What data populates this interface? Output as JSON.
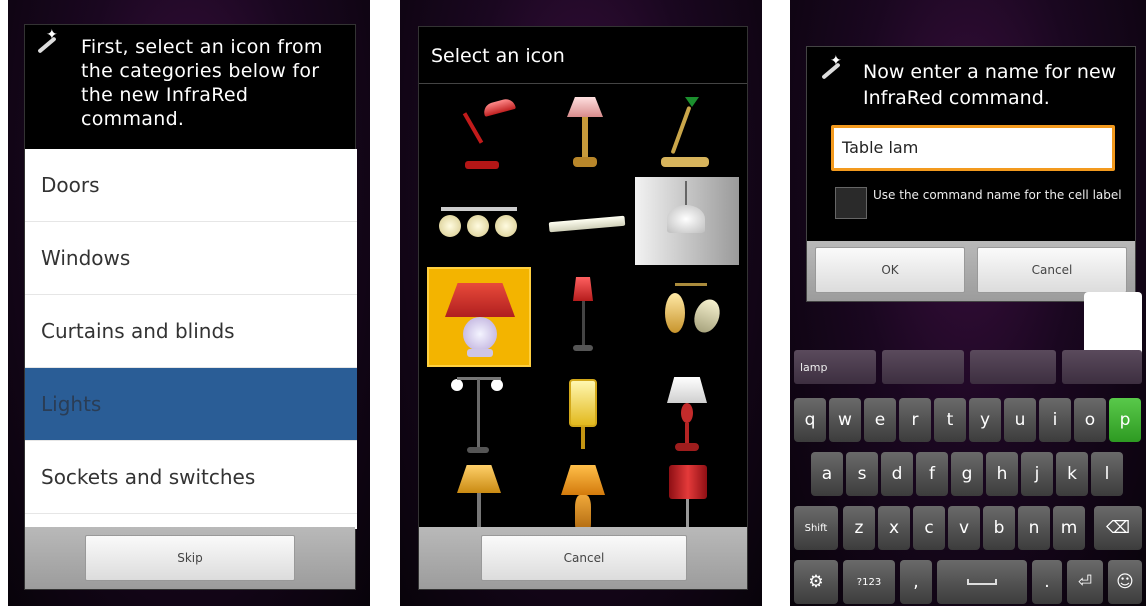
{
  "screen1": {
    "message": "First, select an icon from the categories below for the new InfraRed command.",
    "categories": [
      "Doors",
      "Windows",
      "Curtains and blinds",
      "Lights",
      "Sockets and switches"
    ],
    "selected_category": "Lights",
    "skip_label": "Skip",
    "colors": {
      "selected_row": "#2a5d96"
    }
  },
  "screen2": {
    "title": "Select an icon",
    "icons": [
      "red-desk-lamp-icon",
      "pink-table-lamp-icon",
      "green-desk-lamp-icon",
      "ceiling-spotlights-icon",
      "fluorescent-tube-icon",
      "pendant-lamp-icon",
      "red-shade-table-lamp-icon",
      "red-floor-lamp-icon",
      "wall-sconce-icon",
      "twin-floor-lamp-icon",
      "lantern-lamp-icon",
      "white-shade-lamp-icon",
      "yellow-floor-lamp-icon",
      "orange-table-lamp-icon",
      "red-drum-lamp-icon"
    ],
    "selected_index": 6,
    "cancel_label": "Cancel",
    "colors": {
      "selected_cell": "#f3b400"
    }
  },
  "screen3": {
    "message": "Now enter a name for new InfraRed command.",
    "name_value": "Table lam",
    "checkbox_label": "Use the command name for the cell label",
    "ok_label": "OK",
    "cancel_label": "Cancel",
    "keyboard": {
      "suggestions": [
        "lamp",
        "",
        "",
        ""
      ],
      "row1": [
        "q",
        "w",
        "e",
        "r",
        "t",
        "y",
        "u",
        "i",
        "o",
        "p"
      ],
      "row2": [
        "a",
        "s",
        "d",
        "f",
        "g",
        "h",
        "j",
        "k",
        "l"
      ],
      "row3": [
        "Shift",
        "z",
        "x",
        "c",
        "v",
        "b",
        "n",
        "m"
      ],
      "row3_backspace_icon": "backspace-icon",
      "row4_left_icon": "settings-icon",
      "row4": [
        "?123",
        ",",
        "",
        "."
      ],
      "row4_enter_icon": "enter-icon",
      "row4_right_icon": "emoji-icon"
    },
    "colors": {
      "input_border": "#f39a1e",
      "active_key": "#59c94a"
    }
  }
}
